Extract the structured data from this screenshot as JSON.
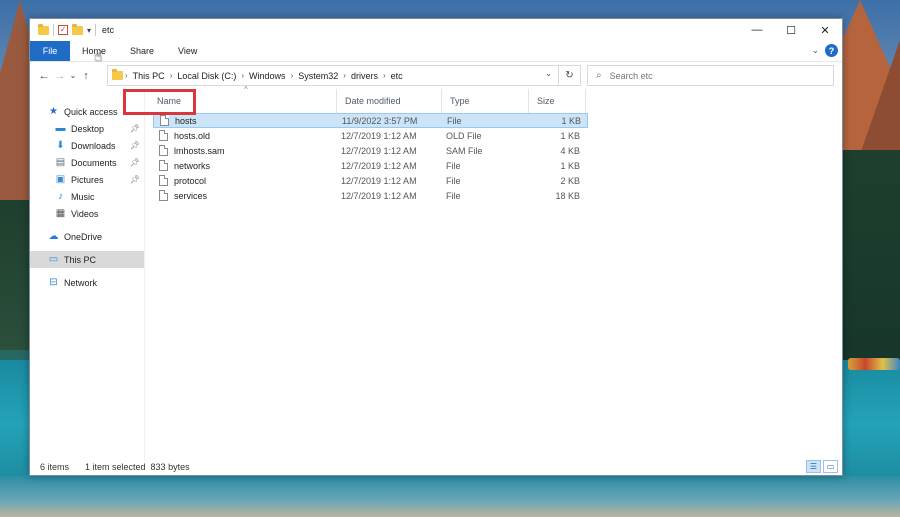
{
  "window": {
    "title": "etc",
    "controls": {
      "minimize": "—",
      "maximize": "☐",
      "close": "✕"
    }
  },
  "ribbon": {
    "tabs": [
      "File",
      "Home",
      "Share",
      "View"
    ]
  },
  "address": {
    "crumbs": [
      "This PC",
      "Local Disk (C:)",
      "Windows",
      "System32",
      "drivers",
      "etc"
    ]
  },
  "search": {
    "placeholder": "Search etc"
  },
  "sidebar": {
    "quick_access": "Quick access",
    "items": [
      {
        "label": "Desktop",
        "icon": "desktop-icon",
        "pinned": true
      },
      {
        "label": "Downloads",
        "icon": "downloads-icon",
        "pinned": true
      },
      {
        "label": "Documents",
        "icon": "documents-icon",
        "pinned": true
      },
      {
        "label": "Pictures",
        "icon": "pictures-icon",
        "pinned": true
      },
      {
        "label": "Music",
        "icon": "music-icon",
        "pinned": false
      },
      {
        "label": "Videos",
        "icon": "videos-icon",
        "pinned": false
      }
    ],
    "onedrive": "OneDrive",
    "this_pc": "This PC",
    "network": "Network"
  },
  "columns": {
    "name": "Name",
    "date": "Date modified",
    "type": "Type",
    "size": "Size"
  },
  "files": [
    {
      "name": "hosts",
      "date": "11/9/2022 3:57 PM",
      "type": "File",
      "size": "1 KB",
      "selected": true
    },
    {
      "name": "hosts.old",
      "date": "12/7/2019 1:12 AM",
      "type": "OLD File",
      "size": "1 KB",
      "selected": false
    },
    {
      "name": "lmhosts.sam",
      "date": "12/7/2019 1:12 AM",
      "type": "SAM File",
      "size": "4 KB",
      "selected": false
    },
    {
      "name": "networks",
      "date": "12/7/2019 1:12 AM",
      "type": "File",
      "size": "1 KB",
      "selected": false
    },
    {
      "name": "protocol",
      "date": "12/7/2019 1:12 AM",
      "type": "File",
      "size": "2 KB",
      "selected": false
    },
    {
      "name": "services",
      "date": "12/7/2019 1:12 AM",
      "type": "File",
      "size": "18 KB",
      "selected": false
    }
  ],
  "status": {
    "count": "6 items",
    "selection": "1 item selected  833 bytes"
  },
  "colors": {
    "accent": "#1e6cc6",
    "selection": "#cce4f7",
    "highlight": "#d9363e"
  }
}
